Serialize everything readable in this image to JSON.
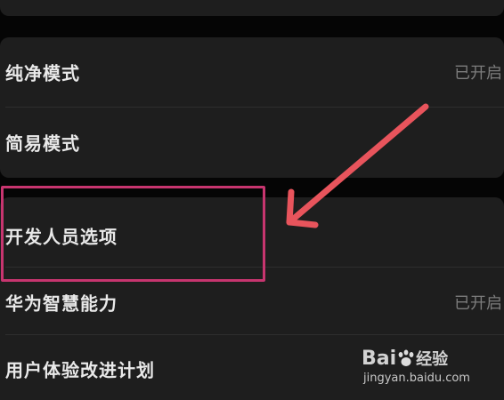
{
  "settings": {
    "rows": [
      {
        "label": "纯净模式",
        "status": "已开启"
      },
      {
        "label": "简易模式",
        "status": ""
      },
      {
        "label": "开发人员选项",
        "status": ""
      },
      {
        "label": "华为智慧能力",
        "status": "已开启"
      },
      {
        "label": "用户体验改进计划",
        "status": ""
      }
    ]
  },
  "annotation": {
    "highlight_color": "#c7356f",
    "arrow_color": "#e8545c"
  },
  "watermark": {
    "logo_text_bai": "Bai",
    "logo_text_jingyan": "经验",
    "url": "jingyan.baidu.com"
  }
}
